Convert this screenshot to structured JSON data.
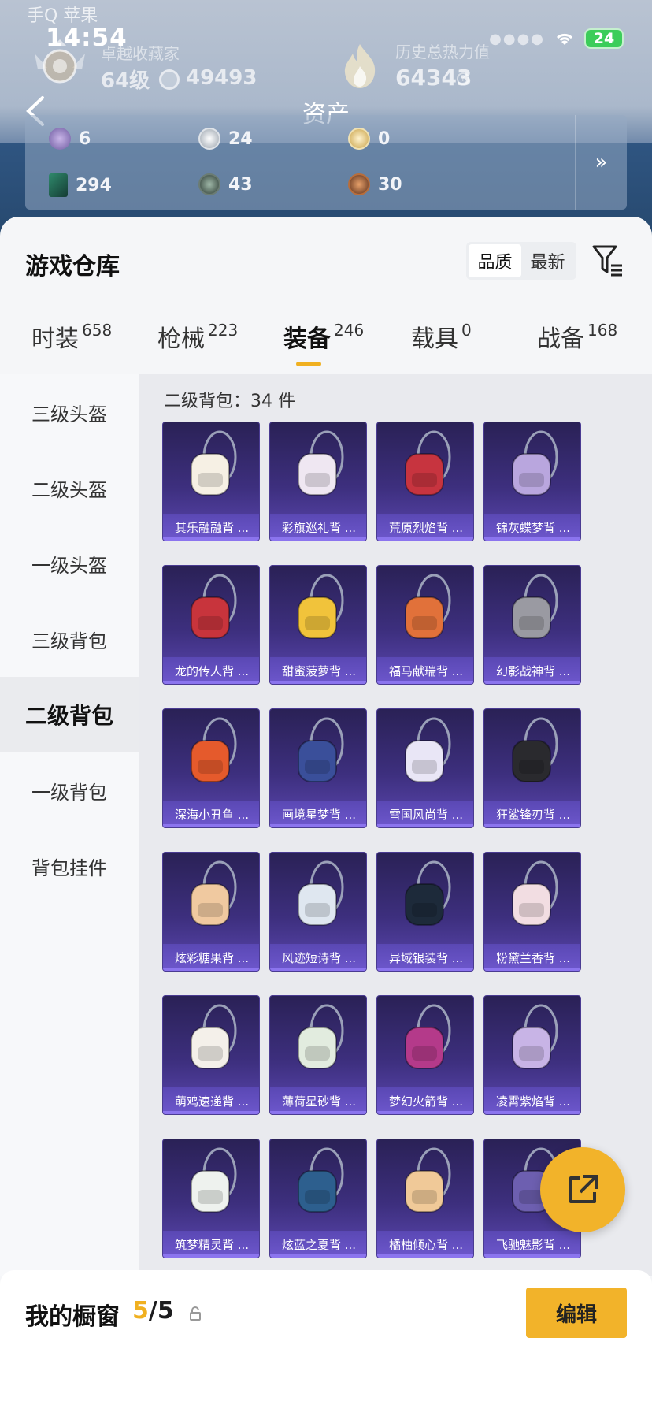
{
  "status_bar": {
    "carrier": "手Q 苹果",
    "time": "14:54",
    "battery": "24"
  },
  "profile": {
    "rank_name": "卓越收藏家",
    "level": "64级",
    "coins": "49493",
    "heat_label": "历史总热力值",
    "heat_value": "64343"
  },
  "header": {
    "title": "资产"
  },
  "assets": {
    "row1": [
      {
        "icon": "purple-ticket-icon",
        "value": "6"
      },
      {
        "icon": "silver-coin-icon",
        "value": "24"
      },
      {
        "icon": "gold-coin-icon",
        "value": "0"
      }
    ],
    "row2": [
      {
        "icon": "card-icon",
        "value": "294"
      },
      {
        "icon": "green-medal-icon",
        "value": "43"
      },
      {
        "icon": "bronze-medal-icon",
        "value": "30"
      }
    ],
    "more_icon": "double-chevron-right-icon"
  },
  "warehouse": {
    "title": "游戏仓库",
    "sort": {
      "quality": "品质",
      "newest": "最新",
      "selected": "品质"
    },
    "tabs": [
      {
        "label": "时装",
        "count": "658"
      },
      {
        "label": "枪械",
        "count": "223"
      },
      {
        "label": "装备",
        "count": "246"
      },
      {
        "label": "载具",
        "count": "0"
      },
      {
        "label": "战备",
        "count": "168"
      }
    ],
    "active_tab": "装备",
    "categories": [
      "三级头盔",
      "二级头盔",
      "一级头盔",
      "三级背包",
      "二级背包",
      "一级背包",
      "背包挂件"
    ],
    "active_category": "二级背包",
    "grid_header": "二级背包：34 件",
    "items": [
      "其乐融融背 ...",
      "彩旗巡礼背 ...",
      "荒原烈焰背 ...",
      "锦灰蝶梦背 ...",
      "龙的传人背 ...",
      "甜蜜菠萝背 ...",
      "福马献瑞背 ...",
      "幻影战神背 ...",
      "深海小丑鱼 ...",
      "画境星梦背 ...",
      "雪国风尚背 ...",
      "狂鲨锋刃背 ...",
      "炫彩糖果背 ...",
      "风迹短诗背 ...",
      "异域银装背 ...",
      "粉黛兰香背 ...",
      "萌鸡速递背 ...",
      "薄荷星砂背 ...",
      "梦幻火箭背 ...",
      "凌霄紫焰背 ...",
      "筑梦精灵背 ...",
      "炫蓝之夏背 ...",
      "橘柚倾心背 ...",
      "飞驰魅影背 ..."
    ],
    "item_colors": [
      "#f6f0e4",
      "#efe7f2",
      "#c7343f",
      "#b9a6de",
      "#c8343c",
      "#f1c33b",
      "#e1713a",
      "#9a9aa2",
      "#e55a2c",
      "#3a4f9a",
      "#e9e6f6",
      "#2a2a2e",
      "#f0c9a0",
      "#dfe7f0",
      "#1d2a3a",
      "#f2dde2",
      "#f4f0ea",
      "#e2ecdf",
      "#b43a8a",
      "#c8b4e6",
      "#eef2ee",
      "#2d5f8e",
      "#f0c998",
      "#6d5fb0"
    ]
  },
  "showcase": {
    "label": "我的橱窗",
    "current": "5",
    "total": "/5",
    "edit": "编辑"
  },
  "colors": {
    "accent": "#f2b32a",
    "card_bg": "#3d2f7e",
    "card_name_bar": "#6d57cc"
  }
}
